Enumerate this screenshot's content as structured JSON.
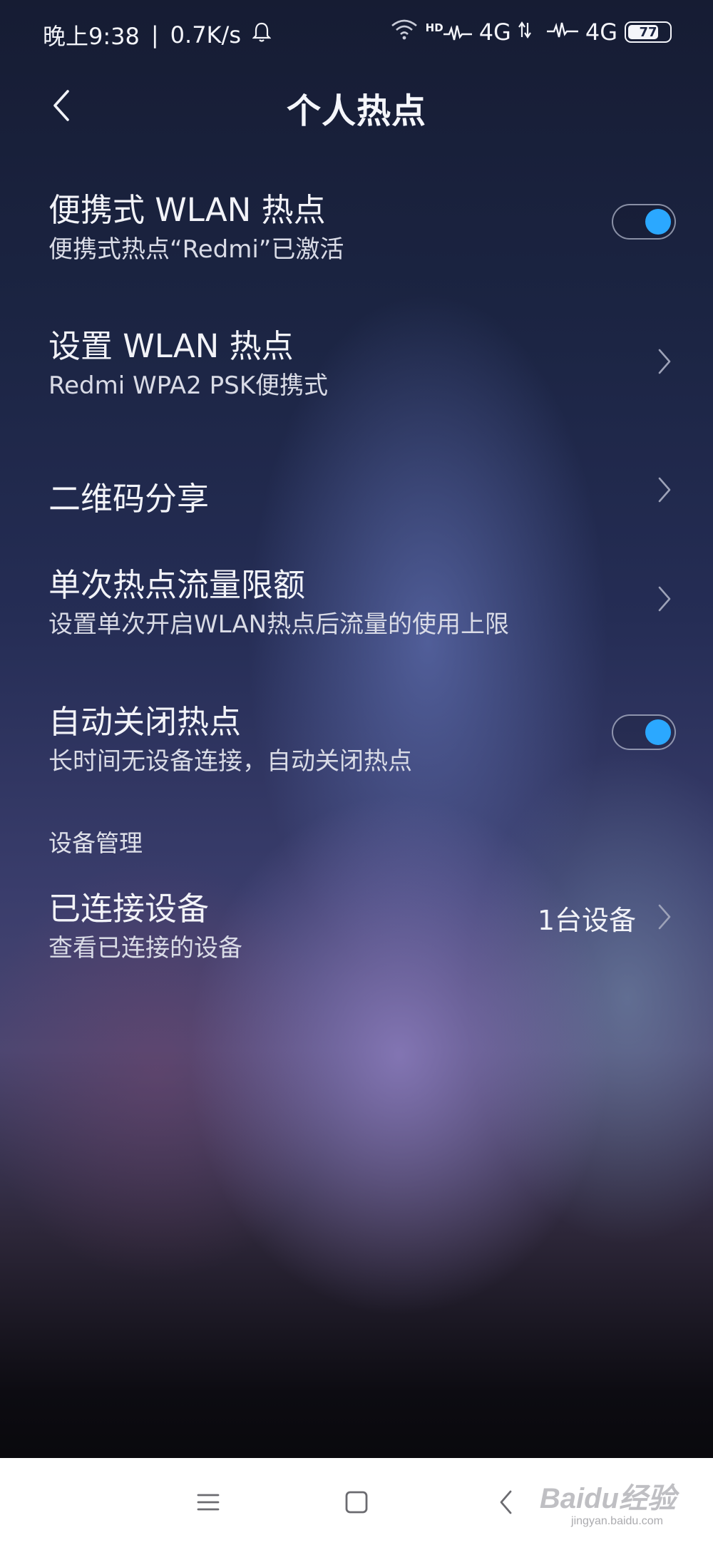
{
  "status_bar": {
    "time": "晚上9:38",
    "separator": "|",
    "speed": "0.7K/s",
    "hd_label": "HD",
    "net1": "4G",
    "net2": "4G",
    "battery": "77",
    "icons": [
      "bell-icon",
      "wifi-icon",
      "signal-icon",
      "data-arrows-icon",
      "battery-icon"
    ]
  },
  "header": {
    "title": "个人热点",
    "back_icon": "chevron-left-icon"
  },
  "settings": {
    "portable_hotspot": {
      "title": "便携式 WLAN 热点",
      "subtitle": "便携式热点“Redmi”已激活",
      "enabled": true
    },
    "setup_hotspot": {
      "title": "设置 WLAN 热点",
      "subtitle": "Redmi WPA2 PSK便携式"
    },
    "qr_share": {
      "title": "二维码分享"
    },
    "data_limit": {
      "title": "单次热点流量限额",
      "subtitle": "设置单次开启WLAN热点后流量的使用上限"
    },
    "auto_close": {
      "title": "自动关闭热点",
      "subtitle": "长时间无设备连接，自动关闭热点",
      "enabled": true
    }
  },
  "device_management": {
    "section_title": "设备管理",
    "connected_devices": {
      "title": "已连接设备",
      "subtitle": "查看已连接的设备",
      "value": "1台设备"
    }
  },
  "nav_bar": {
    "buttons": [
      "menu-icon",
      "home-icon",
      "back-icon"
    ],
    "watermark": "Baidu经验",
    "watermark_sub": "jingyan.baidu.com"
  },
  "colors": {
    "accent": "#2ba8ff",
    "text": "#f2f3f8",
    "nav_bg": "#ffffff"
  }
}
